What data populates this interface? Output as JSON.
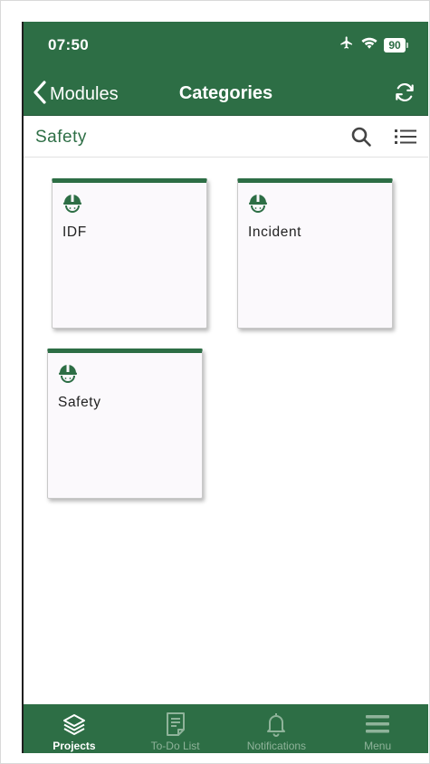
{
  "status": {
    "time": "07:50",
    "battery": "90",
    "icons": [
      "airplane-icon",
      "wifi-icon",
      "battery-icon"
    ]
  },
  "navbar": {
    "back_label": "Modules",
    "title": "Categories",
    "refresh_icon": "refresh-icon"
  },
  "subheader": {
    "title": "Safety",
    "actions": [
      "search-icon",
      "list-view-icon"
    ]
  },
  "categories": [
    {
      "label": "IDF",
      "icon": "hard-hat-icon"
    },
    {
      "label": "Incident",
      "icon": "hard-hat-icon"
    },
    {
      "label": "Safety",
      "icon": "hard-hat-icon"
    }
  ],
  "tabbar": {
    "active": "Projects",
    "tabs": [
      {
        "label": "Projects",
        "icon": "layers-icon"
      },
      {
        "label": "To-Do List",
        "icon": "document-icon"
      },
      {
        "label": "Notifications",
        "icon": "bell-icon"
      },
      {
        "label": "Menu",
        "icon": "hamburger-menu-icon"
      }
    ]
  },
  "colors": {
    "brand_green": "#2d6e45",
    "card_background": "#fbf9fc",
    "tab_inactive": "#8fb39a"
  }
}
